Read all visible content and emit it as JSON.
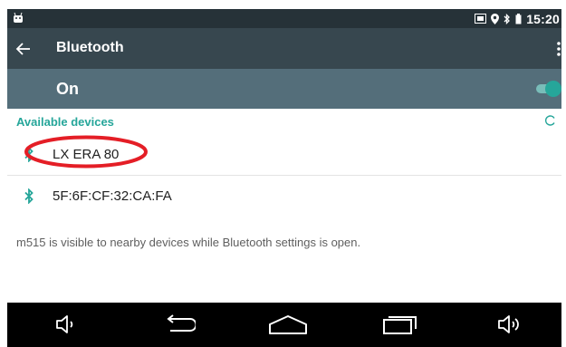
{
  "status_bar": {
    "time": "15:20",
    "icons": [
      "android-icon",
      "cast-icon",
      "location-icon",
      "bluetooth-icon",
      "battery-icon"
    ]
  },
  "app_bar": {
    "title": "Bluetooth",
    "back_icon": "back-arrow-icon",
    "menu_icon": "overflow-menu-icon"
  },
  "master_switch": {
    "label": "On",
    "checked": true
  },
  "devices": {
    "header": "Available devices",
    "items": [
      {
        "name": "LX ERA 80",
        "icon": "bluetooth-icon"
      },
      {
        "name": "5F:6F:CF:32:CA:FA",
        "icon": "bluetooth-icon"
      }
    ]
  },
  "footer_text": "m515 is visible to nearby devices while Bluetooth settings is open.",
  "nav_bar": {
    "buttons": [
      "volume-down-icon",
      "back-icon",
      "home-icon",
      "recents-icon",
      "volume-up-icon"
    ]
  },
  "colors": {
    "status_bar_bg": "#263238",
    "app_bar_bg": "#37474f",
    "master_bg": "#546e7a",
    "accent": "#26a69a",
    "annotation": "#e41e26",
    "nav_bar_bg": "#000000"
  }
}
